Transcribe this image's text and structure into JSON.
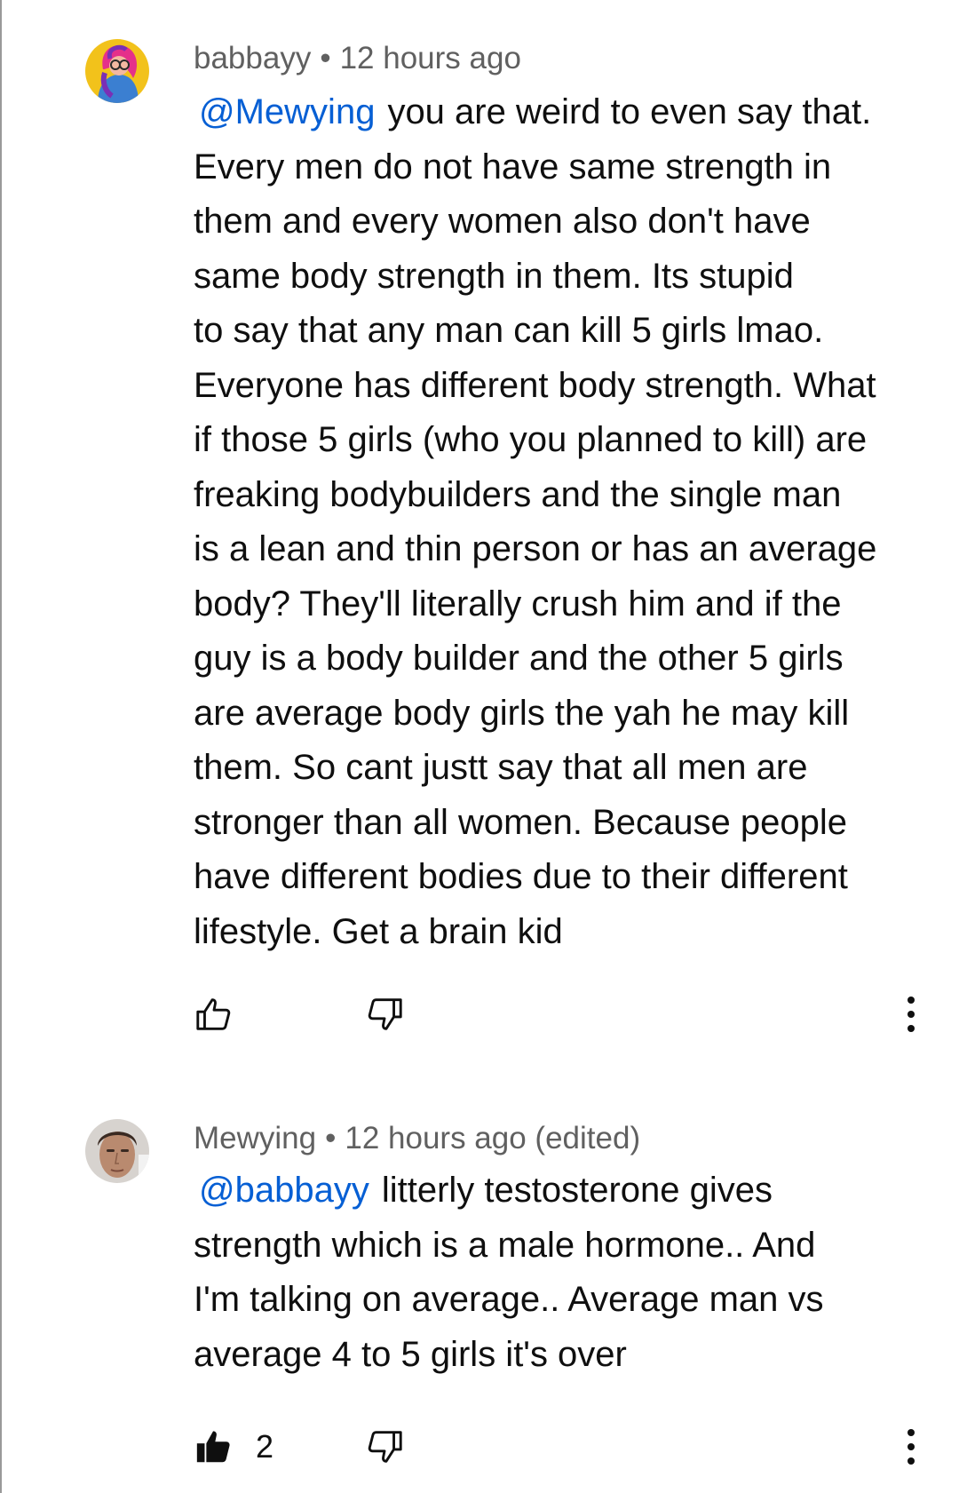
{
  "comments": [
    {
      "author": "babbayy",
      "separator": "•",
      "time": "12 hours ago",
      "mention": "@Mewying",
      "text_lines": [
        "you are weird to even say that.",
        "Every men do not have same strength in",
        "them and every women also don't have",
        "same body strength in them. Its stupid",
        "to say that any man can kill 5 girls lmao.",
        "Everyone has different body strength. What",
        "if those 5 girls (who you planned to kill) are",
        "freaking bodybuilders and the single man",
        "is a lean and thin person or has an average",
        "body? They'll literally crush him and if the",
        "guy is a body builder and the other 5 girls",
        "are average body girls the yah he may kill",
        "them. So cant justt say that all men are",
        "stronger than all women. Because people",
        "have different bodies due to their different",
        "lifestyle. Get a brain kid"
      ],
      "like_count": "",
      "liked": false,
      "icons": {
        "avatar": "cartoon-avatar-icon",
        "like": "thumbs-up-outline-icon",
        "dislike": "thumbs-down-outline-icon",
        "more": "more-vert-icon"
      }
    },
    {
      "author": "Mewying",
      "separator": "•",
      "time": "12 hours ago (edited)",
      "mention": "@babbayy",
      "text_lines": [
        "litterly testosterone gives",
        "strength which is a  male hormone.. And",
        "I'm talking on average.. Average man vs",
        "average 4 to 5 girls it's over"
      ],
      "like_count": "2",
      "liked": true,
      "icons": {
        "avatar": "face-photo-avatar-icon",
        "like": "thumbs-up-filled-icon",
        "dislike": "thumbs-down-outline-icon",
        "more": "more-vert-icon"
      }
    }
  ],
  "colors": {
    "mention": "#065fd4",
    "meta": "#606060",
    "text": "#0f0f0f",
    "background": "#ffffff"
  }
}
